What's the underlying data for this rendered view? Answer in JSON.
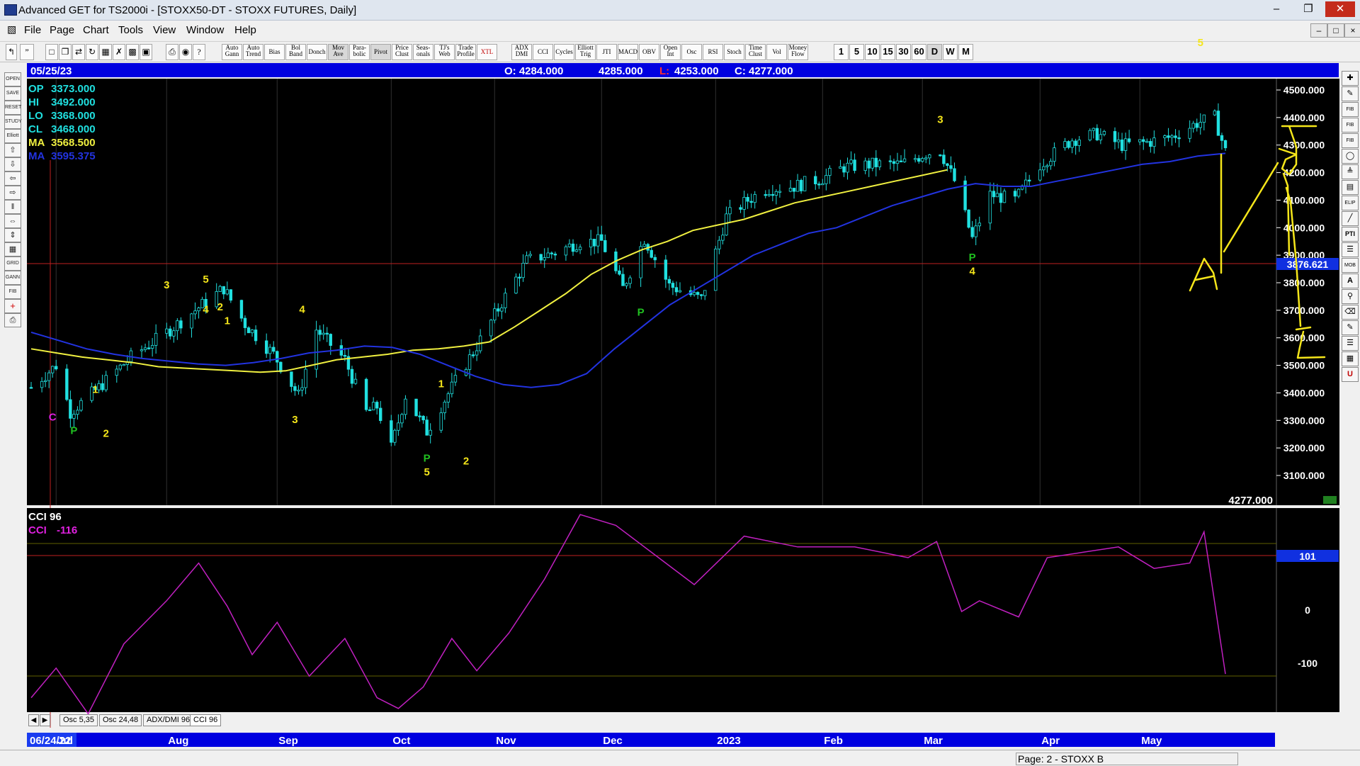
{
  "window": {
    "title": "Advanced GET for TS2000i - [STOXX50-DT - STOXX FUTURES, Daily]",
    "min_label": "–",
    "restore_label": "❐",
    "close_label": "✕"
  },
  "menu": [
    "File",
    "Page",
    "Chart",
    "Tools",
    "View",
    "Window",
    "Help"
  ],
  "toolbar": {
    "indicator_buttons": [
      "Auto Gann",
      "Auto Trend",
      "Bias",
      "Bol Band",
      "Donch",
      "Mov Ave",
      "Para-bolic",
      "Pivot",
      "Price Clust",
      "Seas-onals",
      "TJ's Web",
      "Trade Profile",
      "XTL",
      "ADX DMI",
      "CCI",
      "Cycles",
      "Elliott Trig",
      "JTI",
      "MACD",
      "OBV",
      "Open Int",
      "Osc",
      "RSI",
      "Stoch",
      "Time Clust",
      "Vol",
      "Money Flow"
    ],
    "timeframes": [
      "1",
      "5",
      "10",
      "15",
      "30",
      "60",
      "D",
      "W",
      "M"
    ],
    "active_timeframe": "D"
  },
  "left_tool_labels": [
    "OPEN",
    "SAVE",
    "RESET",
    "STUDY",
    "Elliott",
    "UP",
    "DN",
    "LT",
    "RT",
    "ZIN",
    "ZOUT",
    "GRID",
    "LINES",
    "GANN",
    "FIB",
    "CROSS",
    "PRINT"
  ],
  "right_tool_labels": [
    "PTI"
  ],
  "info_bar": {
    "date": "05/25/23",
    "open": "O: 4284.000",
    "high": "4285.000",
    "low_prefix": "L:",
    "low": "4253.000",
    "close": "C: 4277.000"
  },
  "legend": [
    {
      "label": "OP",
      "value": "3373.000"
    },
    {
      "label": "HI",
      "value": "3492.000"
    },
    {
      "label": "LO",
      "value": "3368.000"
    },
    {
      "label": "CL",
      "value": "3468.000"
    },
    {
      "label": "MA",
      "value": "3568.500"
    },
    {
      "label": "MA",
      "value": "3595.375"
    }
  ],
  "cross_price": "3876.621",
  "last_price": "4277.000",
  "cci": {
    "title": "CCI 96",
    "label": "CCI",
    "value": "-116",
    "ref_label": "101",
    "ticks": [
      "0",
      "-100"
    ]
  },
  "tabs": [
    "Osc 5,35",
    "Osc 24,48",
    "ADX/DMI 96",
    "CCI 96"
  ],
  "active_tab": "CCI 96",
  "x_axis": {
    "start_label": "06/24/22",
    "months": [
      "Jul",
      "Aug",
      "Sep",
      "Oct",
      "Nov",
      "Dec",
      "2023",
      "Feb",
      "Mar",
      "Apr",
      "May"
    ]
  },
  "status": "Page: 2 - STOXX B",
  "colors": {
    "chart_bg": "#000000",
    "up_bar": "#20e0e0",
    "wave_label": "#f5e61a",
    "pivot_label": "#20c020",
    "ma_fast": "#f0f040",
    "ma_slow": "#2233e0",
    "cci_line": "#c020c0",
    "info_bar": "#0000e0"
  },
  "chart_data": [
    {
      "type": "candlestick",
      "title": "STOXX50-DT - STOXX FUTURES, Daily",
      "x_range": [
        "06/24/22",
        "05/25/23"
      ],
      "ylim": [
        3000,
        4550
      ],
      "y_ticks": [
        3100,
        3200,
        3300,
        3400,
        3500,
        3600,
        3700,
        3800,
        3900,
        4000,
        4100,
        4200,
        4300,
        4400,
        4500
      ],
      "x": [
        "2022-06-24",
        "2022-07-01",
        "2022-07-05",
        "2022-07-13",
        "2022-07-22",
        "2022-08-01",
        "2022-08-10",
        "2022-08-17",
        "2022-08-23",
        "2022-08-31",
        "2022-09-07",
        "2022-09-12",
        "2022-09-20",
        "2022-09-26",
        "2022-09-29",
        "2022-10-03",
        "2022-10-07",
        "2022-10-13",
        "2022-10-20",
        "2022-10-27",
        "2022-11-04",
        "2022-11-10",
        "2022-11-18",
        "2022-11-25",
        "2022-12-01",
        "2022-12-07",
        "2022-12-13",
        "2022-12-20",
        "2022-12-29",
        "2023-01-05",
        "2023-01-11",
        "2023-01-16",
        "2023-01-24",
        "2023-02-01",
        "2023-02-07",
        "2023-02-15",
        "2023-02-23",
        "2023-03-02",
        "2023-03-06",
        "2023-03-10",
        "2023-03-15",
        "2023-03-20",
        "2023-03-27",
        "2023-04-03",
        "2023-04-12",
        "2023-04-19",
        "2023-04-26",
        "2023-05-03",
        "2023-05-10",
        "2023-05-17",
        "2023-05-22",
        "2023-05-25"
      ],
      "series": [
        {
          "name": "Close",
          "values": [
            3420,
            3500,
            3330,
            3420,
            3530,
            3620,
            3710,
            3780,
            3650,
            3540,
            3390,
            3630,
            3520,
            3330,
            3350,
            3200,
            3390,
            3260,
            3420,
            3570,
            3750,
            3880,
            3910,
            3950,
            3950,
            3780,
            3960,
            3790,
            3740,
            4040,
            4100,
            4140,
            4150,
            4180,
            4220,
            4230,
            4230,
            4270,
            4280,
            4170,
            3960,
            4120,
            4100,
            4230,
            4320,
            4340,
            4300,
            4310,
            4330,
            4380,
            4400,
            4277
          ]
        },
        {
          "name": "MA 3568.500",
          "values": [
            3560,
            3545,
            3530,
            3520,
            3510,
            3495,
            3490,
            3485,
            3480,
            3475,
            3480,
            3500,
            3520,
            3530,
            3540,
            3555,
            3560,
            3570,
            3585,
            3640,
            3700,
            3760,
            3830,
            3880,
            3920,
            3950,
            3990,
            4010,
            4030,
            4060,
            4090,
            4110,
            4130,
            4150,
            4170,
            4190,
            4210
          ]
        },
        {
          "name": "MA 3595.375",
          "values": [
            3620,
            3590,
            3560,
            3540,
            3525,
            3515,
            3505,
            3500,
            3510,
            3525,
            3545,
            3555,
            3570,
            3565,
            3540,
            3500,
            3460,
            3430,
            3420,
            3430,
            3470,
            3560,
            3640,
            3720,
            3780,
            3840,
            3900,
            3940,
            3980,
            4000,
            4040,
            4080,
            4110,
            4140,
            4160,
            4150,
            4150,
            4170,
            4190,
            4210,
            4230,
            4240,
            4260,
            4270
          ]
        }
      ],
      "annotations": [
        "C",
        "P",
        "1",
        "2",
        "3",
        "5",
        "2",
        "4",
        "1",
        "4",
        "3",
        "1",
        "P",
        "5",
        "2",
        "P",
        "3",
        "P",
        "4",
        "5"
      ]
    },
    {
      "type": "line",
      "title": "CCI 96",
      "ylim": [
        -200,
        200
      ],
      "reference_line": 101,
      "y_ticks": [
        0,
        -100
      ],
      "x": [
        "2022-06-24",
        "2022-07-01",
        "2022-07-10",
        "2022-07-20",
        "2022-08-01",
        "2022-08-10",
        "2022-08-18",
        "2022-08-25",
        "2022-09-01",
        "2022-09-10",
        "2022-09-20",
        "2022-09-29",
        "2022-10-05",
        "2022-10-12",
        "2022-10-20",
        "2022-10-27",
        "2022-11-05",
        "2022-11-15",
        "2022-11-25",
        "2022-12-05",
        "2022-12-15",
        "2022-12-27",
        "2023-01-10",
        "2023-01-25",
        "2023-02-10",
        "2023-02-25",
        "2023-03-05",
        "2023-03-12",
        "2023-03-17",
        "2023-03-28",
        "2023-04-05",
        "2023-04-15",
        "2023-04-25",
        "2023-05-05",
        "2023-05-15",
        "2023-05-19",
        "2023-05-25"
      ],
      "values": [
        -160,
        -105,
        -190,
        -60,
        20,
        90,
        10,
        -80,
        -20,
        -120,
        -50,
        -160,
        -180,
        -140,
        -50,
        -110,
        -40,
        60,
        180,
        160,
        110,
        50,
        140,
        120,
        120,
        100,
        130,
        0,
        20,
        -10,
        100,
        110,
        120,
        80,
        90,
        148,
        -116
      ]
    }
  ]
}
